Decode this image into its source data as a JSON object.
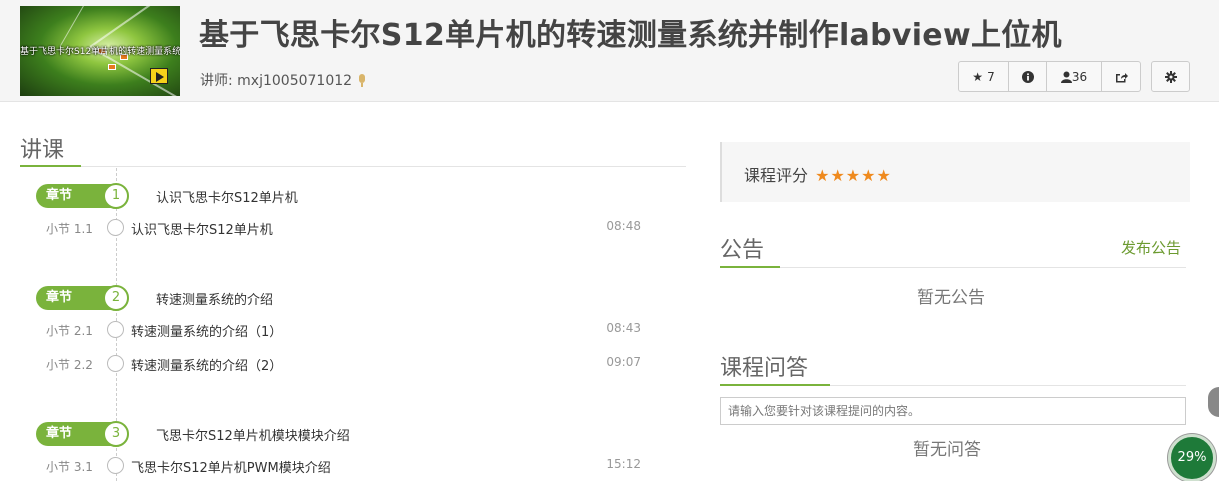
{
  "course": {
    "title": "基于飞思卡尔S12单片机的转速测量系统并制作labview上位机",
    "thumbnail_caption": "基于飞思卡尔S12单片机的转速测量系统",
    "lecturer_label": "讲师: ",
    "lecturer_name": "mxj1005071012"
  },
  "actions": {
    "favorite_count": "7",
    "students_count": "36",
    "icons": [
      "star-icon",
      "info-icon",
      "user-icon",
      "share-icon",
      "gear-icon"
    ]
  },
  "lectures": {
    "title": "讲课",
    "chapter_label": "章节",
    "chapters": [
      {
        "number": "1",
        "title": "认识飞思卡尔S12单片机",
        "lessons": [
          {
            "number": "小节 1.1",
            "title": "认识飞思卡尔S12单片机",
            "duration": "08:48"
          }
        ]
      },
      {
        "number": "2",
        "title": "转速测量系统的介绍",
        "lessons": [
          {
            "number": "小节 2.1",
            "title": "转速测量系统的介绍（1）",
            "duration": "08:43"
          },
          {
            "number": "小节 2.2",
            "title": "转速测量系统的介绍（2）",
            "duration": "09:07"
          }
        ]
      },
      {
        "number": "3",
        "title": "飞思卡尔S12单片机模块模块介绍",
        "lessons": [
          {
            "number": "小节 3.1",
            "title": "飞思卡尔S12单片机PWM模块介绍",
            "duration": "15:12"
          }
        ]
      }
    ]
  },
  "rating": {
    "label": "课程评分",
    "stars": "★★★★★",
    "value": 5
  },
  "announcement": {
    "title": "公告",
    "publish_label": "发布公告",
    "empty_text": "暂无公告"
  },
  "qa": {
    "title": "课程问答",
    "placeholder": "请输入您要针对该课程提问的内容。",
    "empty_text": "暂无问答"
  },
  "progress": {
    "label": "29%",
    "value": 0.29
  },
  "colors": {
    "accent": "#7ab33c",
    "star": "#ef8a1e",
    "progress_bg": "#1e7a39"
  }
}
